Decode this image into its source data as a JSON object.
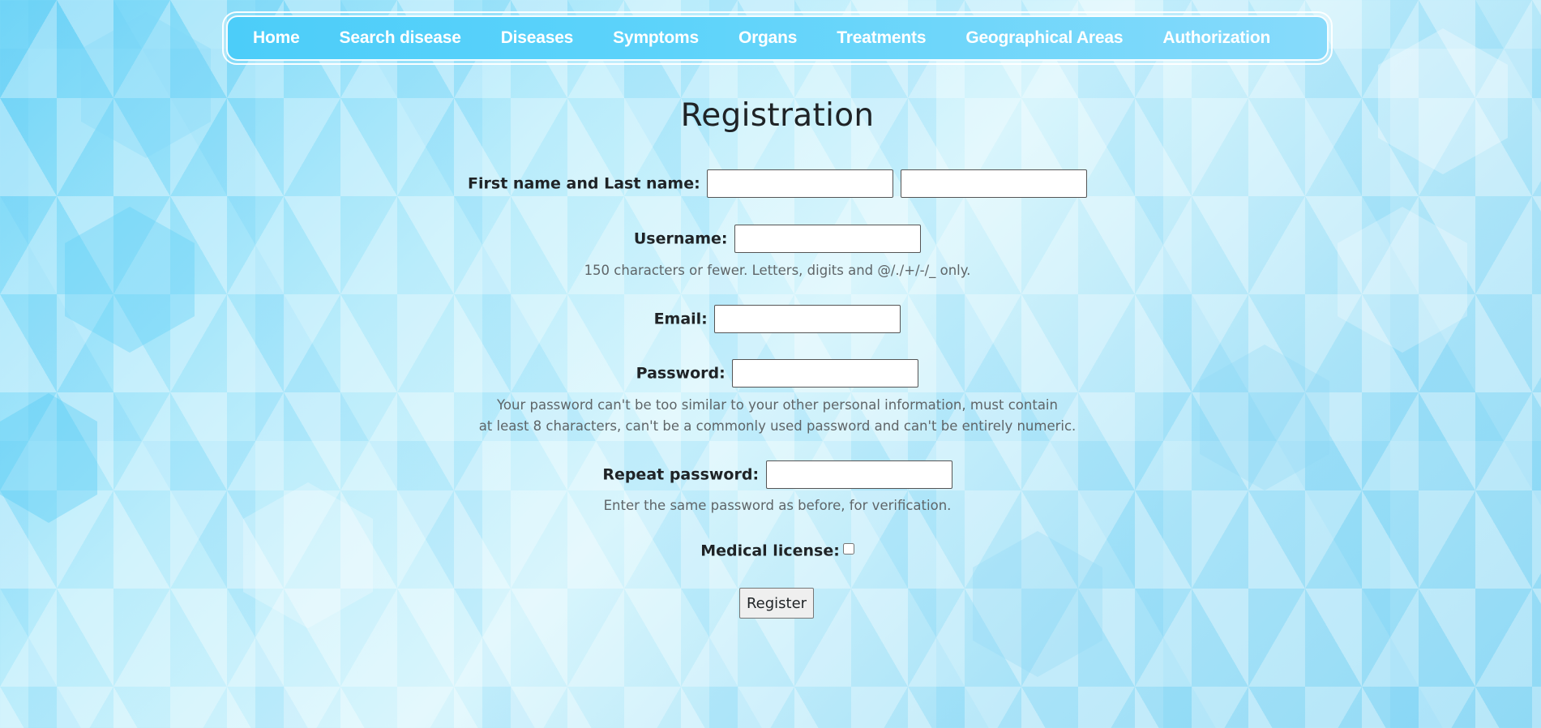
{
  "nav": {
    "items": [
      {
        "label": "Home"
      },
      {
        "label": "Search disease"
      },
      {
        "label": "Diseases"
      },
      {
        "label": "Symptoms"
      },
      {
        "label": "Organs"
      },
      {
        "label": "Treatments"
      },
      {
        "label": "Geographical Areas"
      },
      {
        "label": "Authorization"
      }
    ]
  },
  "form": {
    "title": "Registration",
    "name_label": "First name and Last name:",
    "first_name_value": "",
    "last_name_value": "",
    "username_label": "Username:",
    "username_value": "",
    "username_help": "150 characters or fewer. Letters, digits and @/./+/-/_ only.",
    "email_label": "Email:",
    "email_value": "",
    "password_label": "Password:",
    "password_help_line1": "Your password can't be too similar to your other personal information, must contain",
    "password_help_line2": "at least 8 characters, can't be a commonly used password and can't be entirely numeric.",
    "repeat_password_label": "Repeat password:",
    "repeat_password_help": "Enter the same password as before, for verification.",
    "medical_license_label": "Medical license:",
    "medical_license_checked": false,
    "register_label": "Register"
  },
  "colors": {
    "nav_start": "#4ccdf9",
    "nav_end": "#86dafb",
    "nav_text": "#ffffff",
    "help_text": "#5f6568"
  }
}
